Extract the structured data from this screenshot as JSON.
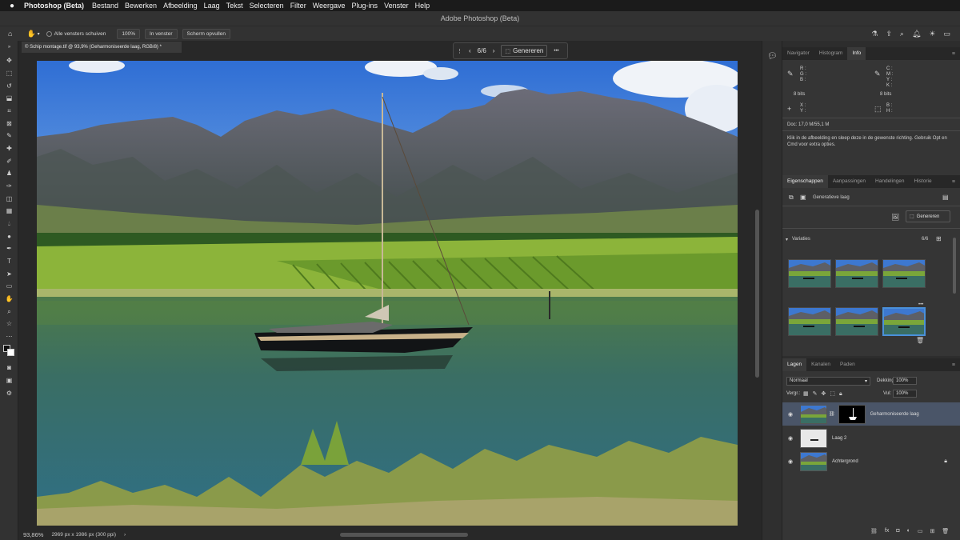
{
  "menubar": {
    "apple": "",
    "items": [
      "Photoshop (Beta)",
      "Bestand",
      "Bewerken",
      "Afbeelding",
      "Laag",
      "Tekst",
      "Selecteren",
      "Filter",
      "Weergave",
      "Plug-ins",
      "Venster",
      "Help"
    ]
  },
  "window_title": "Adobe Photoshop (Beta)",
  "options_bar": {
    "all_windows": "Alle vensters schuiven",
    "zoom_btn": "100%",
    "fit_btn": "In venster",
    "fill_btn": "Scherm opvullen"
  },
  "document": {
    "tab_label": "© Schip montage.tif @ 93,9% (Geharmoniseerde laag, RGB/8) *"
  },
  "context_bar": {
    "counter": "6/6",
    "generate": "Genereren",
    "more": "•••"
  },
  "status": {
    "zoom": "93,86%",
    "info": "2969 px x 1986 px (300 ppi)"
  },
  "panel_top": {
    "tabs": [
      "Navigator",
      "Histogram",
      "Info"
    ],
    "active_tab": "Info",
    "rgb_labels": "R :\nG :\nB :",
    "cmyk_labels": "C :\nM :\nY :\nK :",
    "bits_left": "8 bits",
    "bits_right": "8 bits",
    "xy_labels": "X :\nY :",
    "bh_labels": "B :\nH :",
    "doc_info": "Doc: 17,0 M/55,1 M",
    "hint": "Klik in de afbeelding en sleep deze in de gewenste richting. Gebruik Opt en Cmd voor extra opties."
  },
  "properties": {
    "tabs": [
      "Eigenschappen",
      "Aanpassingen",
      "Handelingen",
      "Historie"
    ],
    "active_tab": "Eigenschappen",
    "layer_type": "Generatieve laag",
    "generate_btn": "Genereren",
    "variations_label": "Variaties",
    "variations_count": "6/6"
  },
  "layers_panel": {
    "tabs": [
      "Lagen",
      "Kanalen",
      "Paden"
    ],
    "active_tab": "Lagen",
    "blend_mode": "Normaal",
    "opacity_label": "Dekking:",
    "opacity_value": "100%",
    "lock_label": "Vergr.:",
    "fill_label": "Vul:",
    "fill_value": "100%",
    "layers": [
      {
        "name": "Geharmoniseerde laag",
        "selected": true
      },
      {
        "name": "Laag 2",
        "selected": false
      },
      {
        "name": "Achtergrond",
        "selected": false
      }
    ]
  },
  "colors": {
    "accent": "#4a90d9",
    "sky": "#3f7fd8",
    "water": "#3c6e66"
  }
}
